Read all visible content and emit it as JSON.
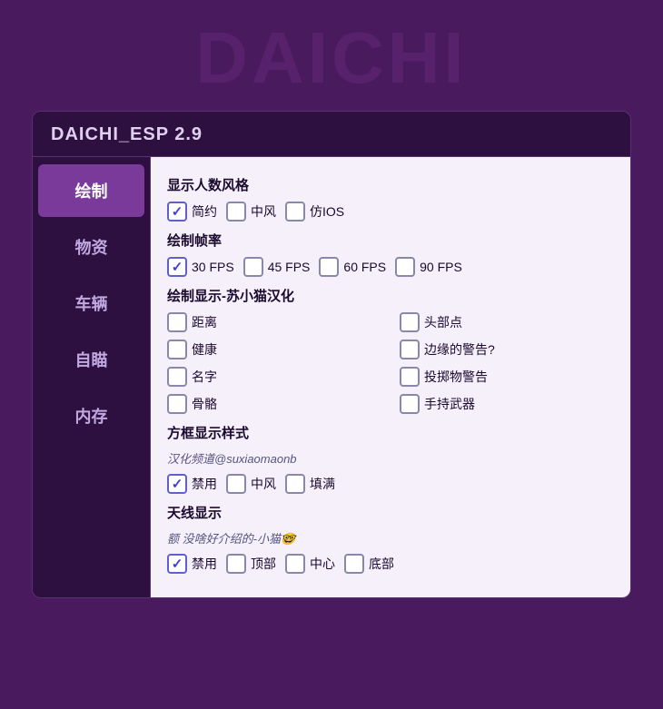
{
  "background_watermark": "DAICHI",
  "title": "DAICHI_ESP  2.9",
  "sidebar": {
    "items": [
      {
        "label": "绘制",
        "active": true
      },
      {
        "label": "物资",
        "active": false
      },
      {
        "label": "车辆",
        "active": false
      },
      {
        "label": "自瞄",
        "active": false
      },
      {
        "label": "内存",
        "active": false
      }
    ]
  },
  "sections": {
    "display_style": {
      "title": "显示人数风格",
      "options": [
        {
          "label": "简约",
          "checked": true
        },
        {
          "label": "中风",
          "checked": false
        },
        {
          "label": "仿IOS",
          "checked": false
        }
      ]
    },
    "frame_rate": {
      "title": "绘制帧率",
      "options": [
        {
          "label": "30 FPS",
          "checked": true
        },
        {
          "label": "45 FPS",
          "checked": false
        },
        {
          "label": "60 FPS",
          "checked": false
        },
        {
          "label": "90 FPS",
          "checked": false
        }
      ]
    },
    "draw_display": {
      "title": "绘制显示-苏小猫汉化",
      "options": [
        {
          "label": "距离",
          "checked": false
        },
        {
          "label": "头部点",
          "checked": false
        },
        {
          "label": "健康",
          "checked": false
        },
        {
          "label": "边缘的警告?",
          "checked": false
        },
        {
          "label": "名字",
          "checked": false
        },
        {
          "label": "投掷物警告",
          "checked": false
        },
        {
          "label": "骨骼",
          "checked": false
        },
        {
          "label": "手持武器",
          "checked": false
        }
      ]
    },
    "box_style": {
      "title": "方框显示样式",
      "subtitle": "汉化频道@suxiaomaonb",
      "options": [
        {
          "label": "禁用",
          "checked": true
        },
        {
          "label": "中风",
          "checked": false
        },
        {
          "label": "填满",
          "checked": false
        }
      ]
    },
    "antenna": {
      "title": "天线显示",
      "subtitle": "额 没啥好介绍的-小猫🤓",
      "options": [
        {
          "label": "禁用",
          "checked": true
        },
        {
          "label": "顶部",
          "checked": false
        },
        {
          "label": "中心",
          "checked": false
        },
        {
          "label": "底部",
          "checked": false
        }
      ]
    }
  }
}
